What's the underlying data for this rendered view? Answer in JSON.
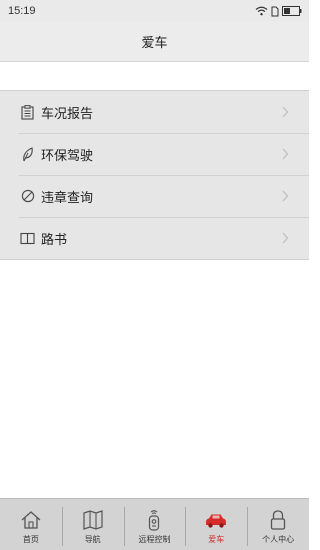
{
  "status_bar": {
    "time": "15:19"
  },
  "header": {
    "title": "爱车"
  },
  "menu": {
    "items": [
      {
        "label": "车况报告"
      },
      {
        "label": "环保驾驶"
      },
      {
        "label": "违章查询"
      },
      {
        "label": "路书"
      }
    ]
  },
  "bottom_nav": {
    "items": [
      {
        "label": "首页"
      },
      {
        "label": "导航"
      },
      {
        "label": "远程控制"
      },
      {
        "label": "爱车"
      },
      {
        "label": "个人中心"
      }
    ],
    "active_index": 3
  },
  "colors": {
    "active": "#d62b2b",
    "icon": "#555555"
  }
}
